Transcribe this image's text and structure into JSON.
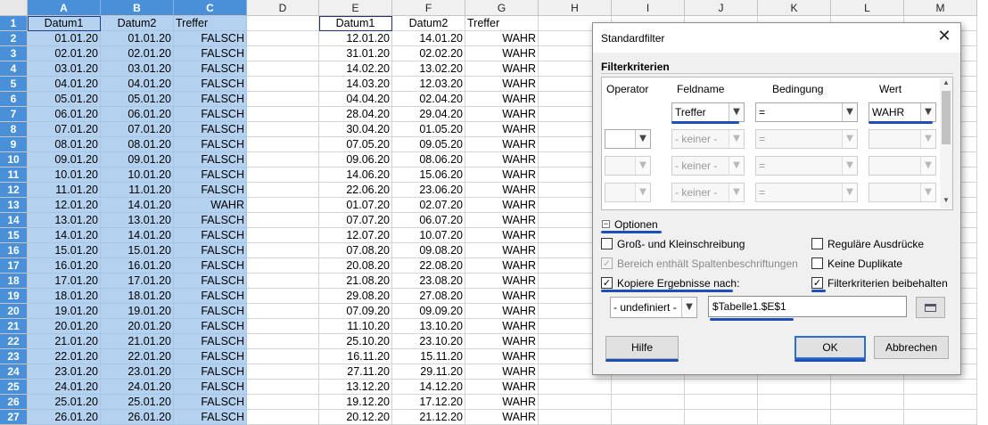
{
  "sheet": {
    "columns": [
      "A",
      "B",
      "C",
      "D",
      "E",
      "F",
      "G",
      "H",
      "I",
      "J",
      "K",
      "L",
      "M"
    ],
    "rows": [
      "1",
      "2",
      "3",
      "4",
      "5",
      "6",
      "7",
      "8",
      "9",
      "10",
      "11",
      "12",
      "13",
      "14",
      "15",
      "16",
      "17",
      "18",
      "19",
      "20",
      "21",
      "22",
      "23",
      "24",
      "25",
      "26",
      "27"
    ],
    "headers": {
      "a": "Datum1",
      "b": "Datum2",
      "c": "Treffer",
      "e": "Datum1",
      "f": "Datum2",
      "g": "Treffer"
    },
    "data_abc": [
      [
        "01.01.20",
        "01.01.20",
        "FALSCH"
      ],
      [
        "02.01.20",
        "02.01.20",
        "FALSCH"
      ],
      [
        "03.01.20",
        "03.01.20",
        "FALSCH"
      ],
      [
        "04.01.20",
        "04.01.20",
        "FALSCH"
      ],
      [
        "05.01.20",
        "05.01.20",
        "FALSCH"
      ],
      [
        "06.01.20",
        "06.01.20",
        "FALSCH"
      ],
      [
        "07.01.20",
        "07.01.20",
        "FALSCH"
      ],
      [
        "08.01.20",
        "08.01.20",
        "FALSCH"
      ],
      [
        "09.01.20",
        "09.01.20",
        "FALSCH"
      ],
      [
        "10.01.20",
        "10.01.20",
        "FALSCH"
      ],
      [
        "11.01.20",
        "11.01.20",
        "FALSCH"
      ],
      [
        "12.01.20",
        "14.01.20",
        "WAHR"
      ],
      [
        "13.01.20",
        "13.01.20",
        "FALSCH"
      ],
      [
        "14.01.20",
        "14.01.20",
        "FALSCH"
      ],
      [
        "15.01.20",
        "15.01.20",
        "FALSCH"
      ],
      [
        "16.01.20",
        "16.01.20",
        "FALSCH"
      ],
      [
        "17.01.20",
        "17.01.20",
        "FALSCH"
      ],
      [
        "18.01.20",
        "18.01.20",
        "FALSCH"
      ],
      [
        "19.01.20",
        "19.01.20",
        "FALSCH"
      ],
      [
        "20.01.20",
        "20.01.20",
        "FALSCH"
      ],
      [
        "21.01.20",
        "21.01.20",
        "FALSCH"
      ],
      [
        "22.01.20",
        "22.01.20",
        "FALSCH"
      ],
      [
        "23.01.20",
        "23.01.20",
        "FALSCH"
      ],
      [
        "24.01.20",
        "24.01.20",
        "FALSCH"
      ],
      [
        "25.01.20",
        "25.01.20",
        "FALSCH"
      ],
      [
        "26.01.20",
        "26.01.20",
        "FALSCH"
      ]
    ],
    "data_efg": [
      [
        "12.01.20",
        "14.01.20",
        "WAHR"
      ],
      [
        "31.01.20",
        "02.02.20",
        "WAHR"
      ],
      [
        "14.02.20",
        "13.02.20",
        "WAHR"
      ],
      [
        "14.03.20",
        "12.03.20",
        "WAHR"
      ],
      [
        "04.04.20",
        "02.04.20",
        "WAHR"
      ],
      [
        "28.04.20",
        "29.04.20",
        "WAHR"
      ],
      [
        "30.04.20",
        "01.05.20",
        "WAHR"
      ],
      [
        "07.05.20",
        "09.05.20",
        "WAHR"
      ],
      [
        "09.06.20",
        "08.06.20",
        "WAHR"
      ],
      [
        "14.06.20",
        "15.06.20",
        "WAHR"
      ],
      [
        "22.06.20",
        "23.06.20",
        "WAHR"
      ],
      [
        "01.07.20",
        "02.07.20",
        "WAHR"
      ],
      [
        "07.07.20",
        "06.07.20",
        "WAHR"
      ],
      [
        "12.07.20",
        "10.07.20",
        "WAHR"
      ],
      [
        "07.08.20",
        "09.08.20",
        "WAHR"
      ],
      [
        "20.08.20",
        "22.08.20",
        "WAHR"
      ],
      [
        "21.08.20",
        "23.08.20",
        "WAHR"
      ],
      [
        "29.08.20",
        "27.08.20",
        "WAHR"
      ],
      [
        "07.09.20",
        "09.09.20",
        "WAHR"
      ],
      [
        "11.10.20",
        "13.10.20",
        "WAHR"
      ],
      [
        "25.10.20",
        "23.10.20",
        "WAHR"
      ],
      [
        "16.11.20",
        "15.11.20",
        "WAHR"
      ],
      [
        "27.11.20",
        "29.11.20",
        "WAHR"
      ],
      [
        "13.12.20",
        "14.12.20",
        "WAHR"
      ],
      [
        "19.12.20",
        "17.12.20",
        "WAHR"
      ],
      [
        "20.12.20",
        "21.12.20",
        "WAHR"
      ]
    ]
  },
  "dialog": {
    "title": "Standardfilter",
    "close_glyph": "✕",
    "section_criteria": "Filterkriterien",
    "col_operator": "Operator",
    "col_fieldname": "Feldname",
    "col_condition": "Bedingung",
    "col_value": "Wert",
    "row1": {
      "field": "Treffer",
      "condition": "=",
      "value": "WAHR"
    },
    "row_none_field": "- keiner -",
    "row_none_condition": "=",
    "options_label": "Optionen",
    "opt_case": "Groß- und Kleinschreibung",
    "opt_regex": "Reguläre Ausdrücke",
    "opt_headers": "Bereich enthält Spaltenbeschriftungen",
    "opt_nodup": "Keine Duplikate",
    "opt_copy": "Kopiere Ergebnisse nach:",
    "opt_keep": "Filterkriterien beibehalten",
    "copy_dropdown": "- undefiniert -",
    "copy_target": "$Tabelle1.$E$1",
    "btn_help": "Hilfe",
    "btn_ok": "OK",
    "btn_cancel": "Abbrechen",
    "accent_color": "#1d4fb8"
  }
}
